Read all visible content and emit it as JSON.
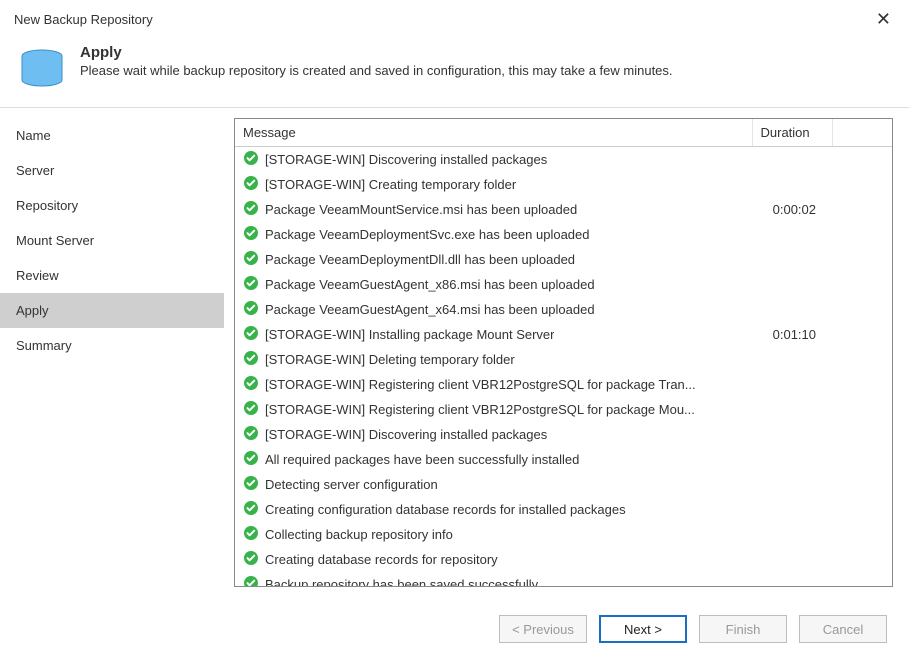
{
  "window": {
    "title": "New Backup Repository"
  },
  "header": {
    "title": "Apply",
    "subtitle": "Please wait while backup repository is created and saved in configuration, this may take a few minutes."
  },
  "sidebar": {
    "items": [
      {
        "label": "Name",
        "active": false
      },
      {
        "label": "Server",
        "active": false
      },
      {
        "label": "Repository",
        "active": false
      },
      {
        "label": "Mount Server",
        "active": false
      },
      {
        "label": "Review",
        "active": false
      },
      {
        "label": "Apply",
        "active": true
      },
      {
        "label": "Summary",
        "active": false
      }
    ]
  },
  "table": {
    "columns": {
      "message": "Message",
      "duration": "Duration"
    },
    "rows": [
      {
        "msg": "[STORAGE-WIN] Discovering installed packages",
        "dur": ""
      },
      {
        "msg": "[STORAGE-WIN] Creating temporary folder",
        "dur": ""
      },
      {
        "msg": "Package VeeamMountService.msi has been uploaded",
        "dur": "0:00:02"
      },
      {
        "msg": "Package VeeamDeploymentSvc.exe has been uploaded",
        "dur": ""
      },
      {
        "msg": "Package VeeamDeploymentDll.dll has been uploaded",
        "dur": ""
      },
      {
        "msg": "Package VeeamGuestAgent_x86.msi has been uploaded",
        "dur": ""
      },
      {
        "msg": "Package VeeamGuestAgent_x64.msi has been uploaded",
        "dur": ""
      },
      {
        "msg": "[STORAGE-WIN] Installing package Mount Server",
        "dur": "0:01:10"
      },
      {
        "msg": "[STORAGE-WIN] Deleting temporary folder",
        "dur": ""
      },
      {
        "msg": "[STORAGE-WIN] Registering client VBR12PostgreSQL for package Tran...",
        "dur": ""
      },
      {
        "msg": "[STORAGE-WIN] Registering client VBR12PostgreSQL for package Mou...",
        "dur": ""
      },
      {
        "msg": "[STORAGE-WIN] Discovering installed packages",
        "dur": ""
      },
      {
        "msg": "All required packages have been successfully installed",
        "dur": ""
      },
      {
        "msg": "Detecting server configuration",
        "dur": ""
      },
      {
        "msg": "Creating configuration database records for installed packages",
        "dur": ""
      },
      {
        "msg": "Collecting backup repository info",
        "dur": ""
      },
      {
        "msg": "Creating database records for repository",
        "dur": ""
      },
      {
        "msg": "Backup repository has been saved successfully",
        "dur": ""
      }
    ]
  },
  "footer": {
    "previous": "< Previous",
    "next": "Next >",
    "finish": "Finish",
    "cancel": "Cancel"
  },
  "icons": {
    "database_fill": "#6fbef2",
    "check_fill": "#37b34a"
  }
}
